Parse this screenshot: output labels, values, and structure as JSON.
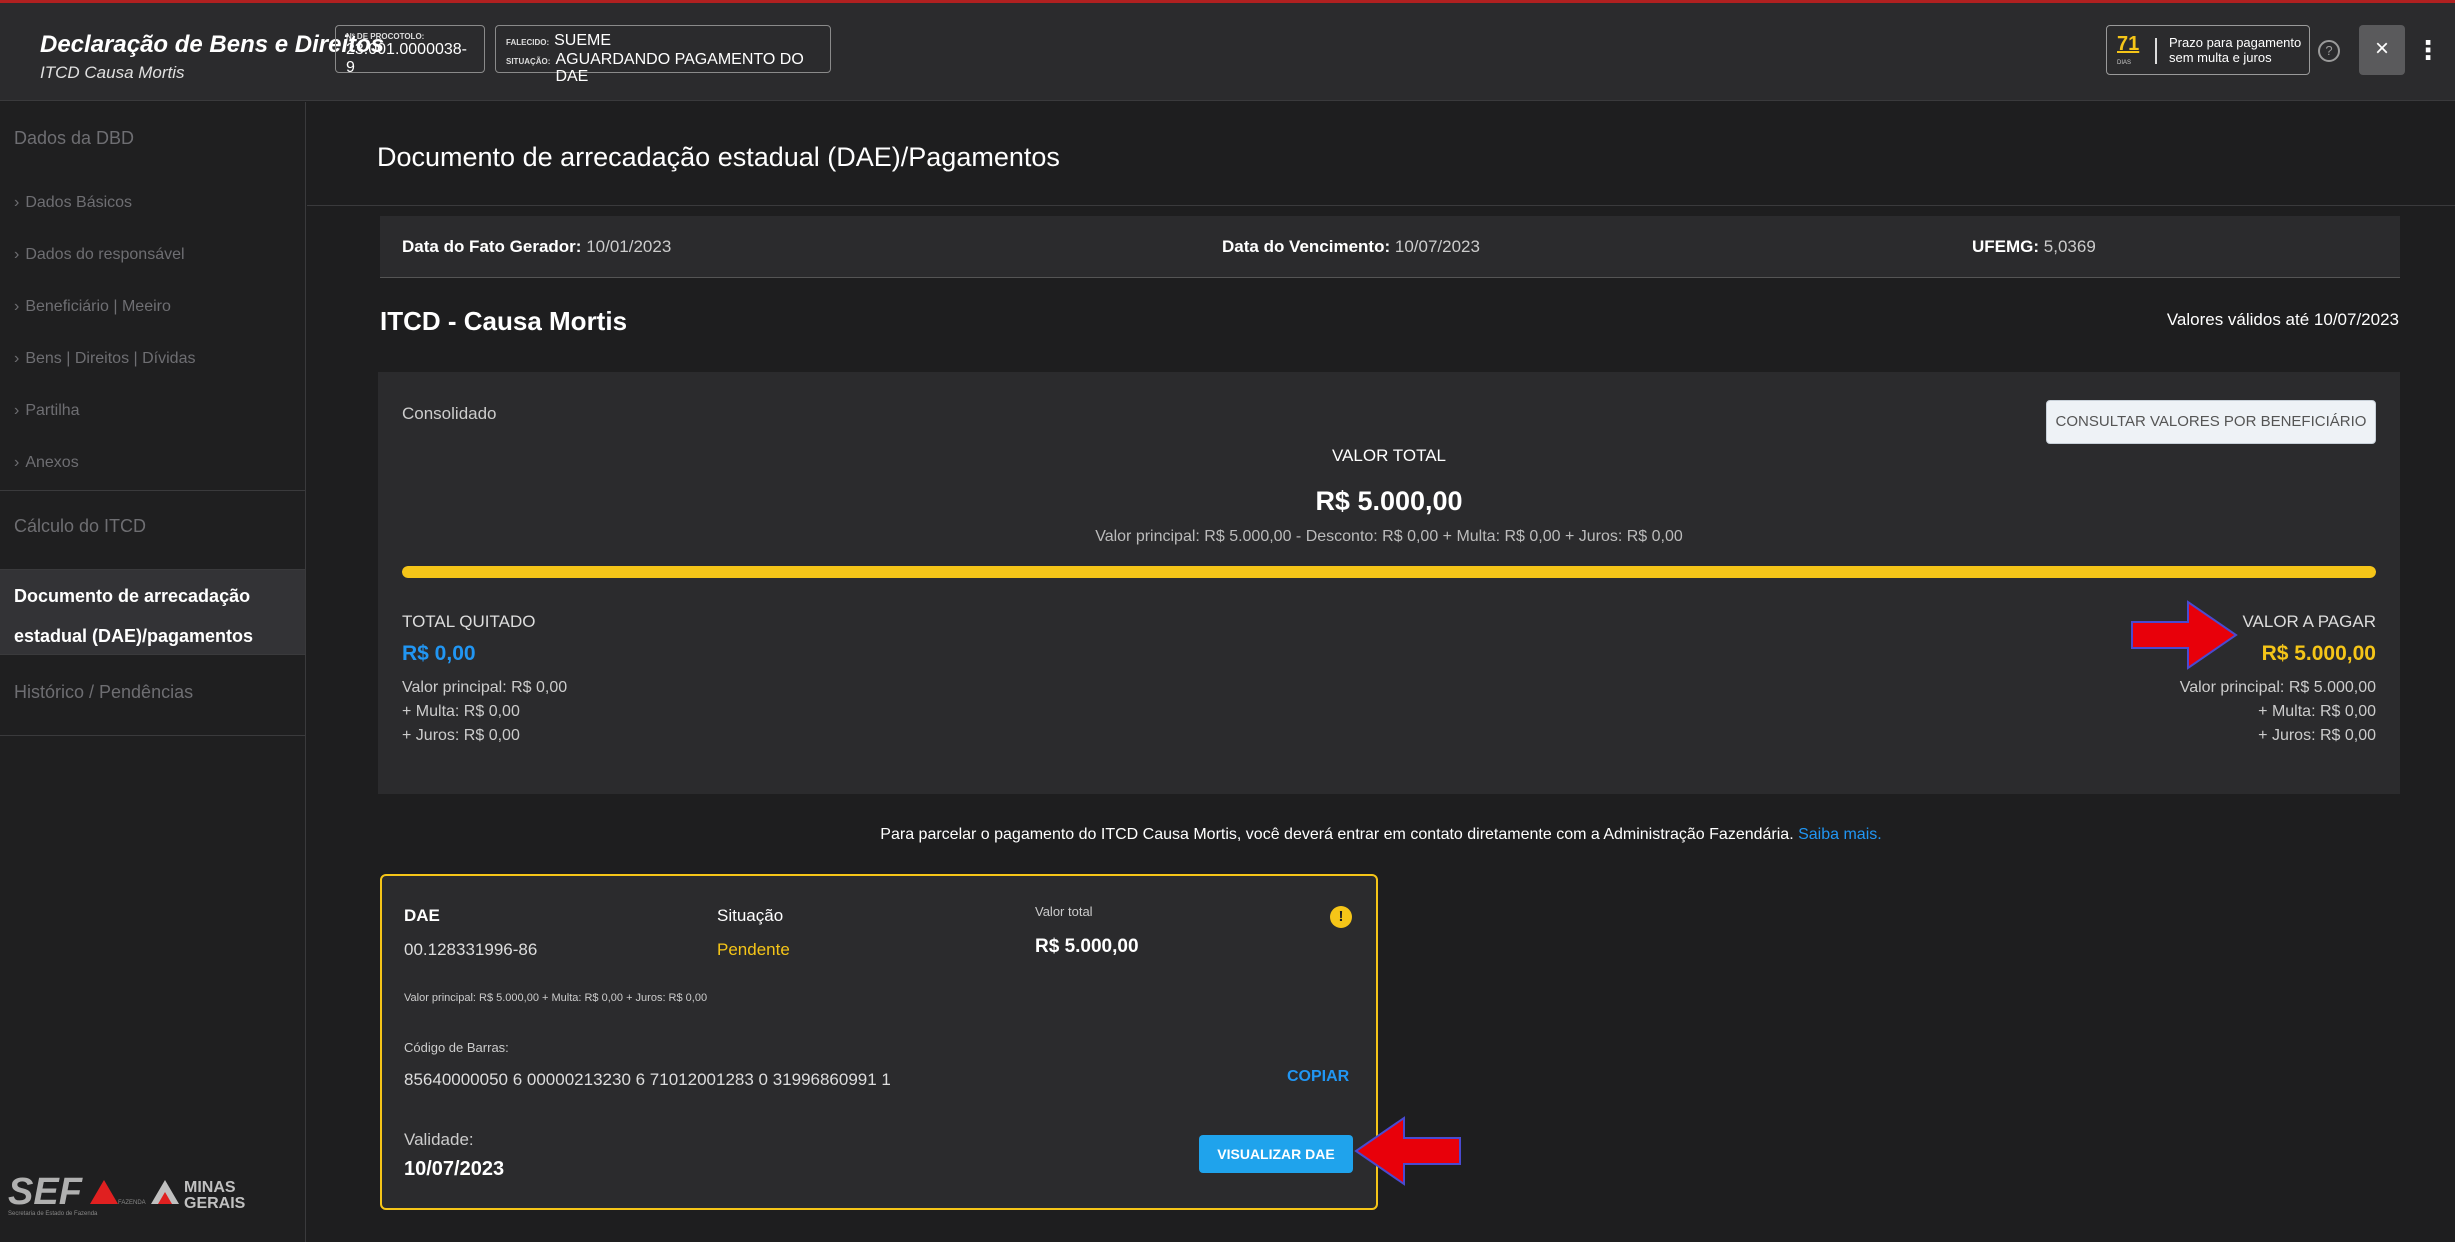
{
  "header": {
    "title": "Declaração de Bens e Direitos",
    "subtitle": "ITCD Causa Mortis",
    "protocol_label": "Nº DE PROCOTOLO:",
    "protocol_value": "23.001.0000038-9",
    "falecido_label": "FALECIDO:",
    "falecido_value": "SUEME",
    "situacao_label": "SITUAÇÃO:",
    "situacao_value": "AGUARDANDO PAGAMENTO DO DAE",
    "prazo_days": "71",
    "prazo_days_unit": "DIAS",
    "prazo_text_1": "Prazo para pagamento",
    "prazo_text_2": "sem multa e juros",
    "help_icon": "?",
    "close_icon": "×",
    "more_icon": "⋮"
  },
  "sidebar": {
    "sections": [
      {
        "label": "Dados da DBD"
      },
      {
        "label": "Cálculo do ITCD"
      },
      {
        "label": "Histórico / Pendências"
      }
    ],
    "items": [
      {
        "label": "Dados Básicos"
      },
      {
        "label": "Dados do responsável"
      },
      {
        "label": "Beneficiário | Meeiro"
      },
      {
        "label": "Bens | Direitos | Dívidas"
      },
      {
        "label": "Partilha"
      },
      {
        "label": "Anexos"
      }
    ],
    "chevron": "›",
    "active": {
      "line1": "Documento de arrecadação",
      "line2": "estadual (DAE)/pagamentos"
    },
    "logo_sef": "SEF",
    "logo_fazenda": "FAZENDA",
    "logo_state": "MINAS",
    "logo_state2": "GERAIS",
    "logo_sub": "Secretaria de Estado de Fazenda"
  },
  "main": {
    "title": "Documento de arrecadação estadual (DAE)/Pagamentos",
    "info": {
      "fato_label": "Data do Fato Gerador:",
      "fato_value": "10/01/2023",
      "venc_label": "Data do Vencimento:",
      "venc_value": "10/07/2023",
      "ufemg_label": "UFEMG:",
      "ufemg_value": "5,0369"
    },
    "section_title": "ITCD - Causa Mortis",
    "valid_until": "Valores válidos até 10/07/2023",
    "consolidado": {
      "label": "Consolidado",
      "consultar_button": "CONSULTAR VALORES POR BENEFICIÁRIO",
      "valor_total_label": "VALOR TOTAL",
      "valor_total": "R$ 5.000,00",
      "valor_detail": "Valor principal: R$ 5.000,00 - Desconto: R$ 0,00 + Multa: R$ 0,00 + Juros: R$ 0,00",
      "progress_percent": 100,
      "total_quitado_label": "TOTAL QUITADO",
      "total_quitado_value": "R$ 0,00",
      "tq_principal": "Valor principal: R$ 0,00",
      "tq_multa": "+ Multa: R$ 0,00",
      "tq_juros": "+ Juros: R$ 0,00",
      "valor_pagar_label": "VALOR A PAGAR",
      "valor_pagar_value": "R$ 5.000,00",
      "vp_principal": "Valor principal: R$ 5.000,00",
      "vp_multa": "+ Multa: R$ 0,00",
      "vp_juros": "+ Juros: R$ 0,00"
    },
    "parcelar_text": "Para parcelar o pagamento do ITCD Causa Mortis, você deverá entrar em contato diretamente com a Administração Fazendária.",
    "saiba_mais": "Saiba mais.",
    "dae_card": {
      "dae_label": "DAE",
      "dae_number": "00.128331996-86",
      "situacao_label": "Situação",
      "situacao_value": "Pendente",
      "valor_total_label": "Valor total",
      "valor_total": "R$ 5.000,00",
      "warn_icon": "!",
      "detail": "Valor principal: R$ 5.000,00 + Multa: R$ 0,00 + Juros: R$ 0,00",
      "codigo_label": "Código de Barras:",
      "codigo_value": "85640000050 6 00000213230 6 71012001283 0 31996860991 1",
      "copiar": "COPIAR",
      "validade_label": "Validade:",
      "validade_value": "10/07/2023",
      "visualizar_button": "VISUALIZAR DAE"
    }
  },
  "colors": {
    "accent_yellow": "#f5c518",
    "accent_blue": "#2196f3",
    "button_blue": "#1fa3ec",
    "arrow_red": "#e8000a"
  }
}
